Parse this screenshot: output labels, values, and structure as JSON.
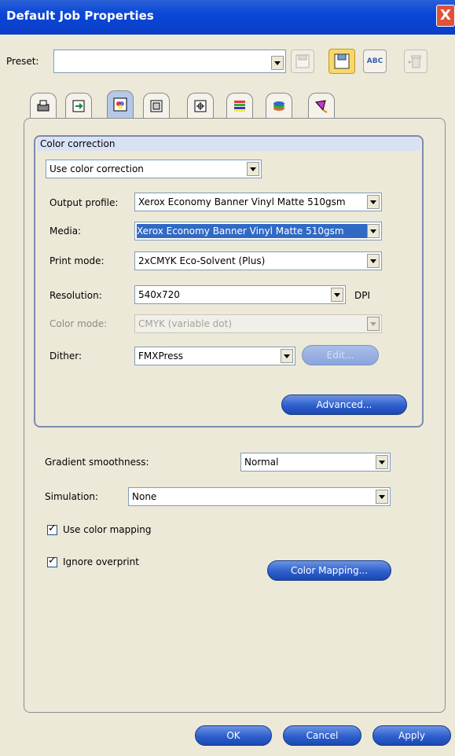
{
  "window": {
    "title": "Default Job Properties",
    "close_label": "X"
  },
  "preset": {
    "label": "Preset:",
    "value": ""
  },
  "toolbar_icons": [
    "save-disabled-icon",
    "save-icon",
    "rename-abc-icon",
    "delete-trash-icon"
  ],
  "toolbar": {
    "abc_label": "ABC"
  },
  "tabs": [
    "printer-tab",
    "layout-tab",
    "color-tab",
    "media-tab",
    "marks-tab",
    "swatch-tab",
    "layers-tab",
    "edit-tab"
  ],
  "color_correction": {
    "title": "Color correction",
    "mode": "Use color correction",
    "output_profile": {
      "label": "Output profile:",
      "value": "Xerox Economy Banner Vinyl Matte 510gsm"
    },
    "media": {
      "label": "Media:",
      "value": "Xerox Economy Banner Vinyl Matte 510gsm"
    },
    "print_mode": {
      "label": "Print mode:",
      "value": "2xCMYK Eco-Solvent (Plus)"
    },
    "resolution": {
      "label": "Resolution:",
      "value": "540x720",
      "unit": "DPI"
    },
    "color_mode": {
      "label": "Color mode:",
      "value": "CMYK (variable dot)"
    },
    "dither": {
      "label": "Dither:",
      "value": "FMXPress",
      "edit_label": "Edit..."
    },
    "advanced_label": "Advanced..."
  },
  "gradient": {
    "label": "Gradient smoothness:",
    "value": "Normal"
  },
  "simulation": {
    "label": "Simulation:",
    "value": "None"
  },
  "use_color_mapping": {
    "label": "Use color mapping",
    "checked": true
  },
  "ignore_overprint": {
    "label": "Ignore overprint",
    "checked": true
  },
  "color_mapping_button": "Color Mapping...",
  "footer": {
    "ok": "OK",
    "cancel": "Cancel",
    "apply": "Apply"
  },
  "colors": {
    "title_bar": "#0a46d8",
    "accent_button": "#2e5fcc",
    "selection": "#316ac5"
  }
}
